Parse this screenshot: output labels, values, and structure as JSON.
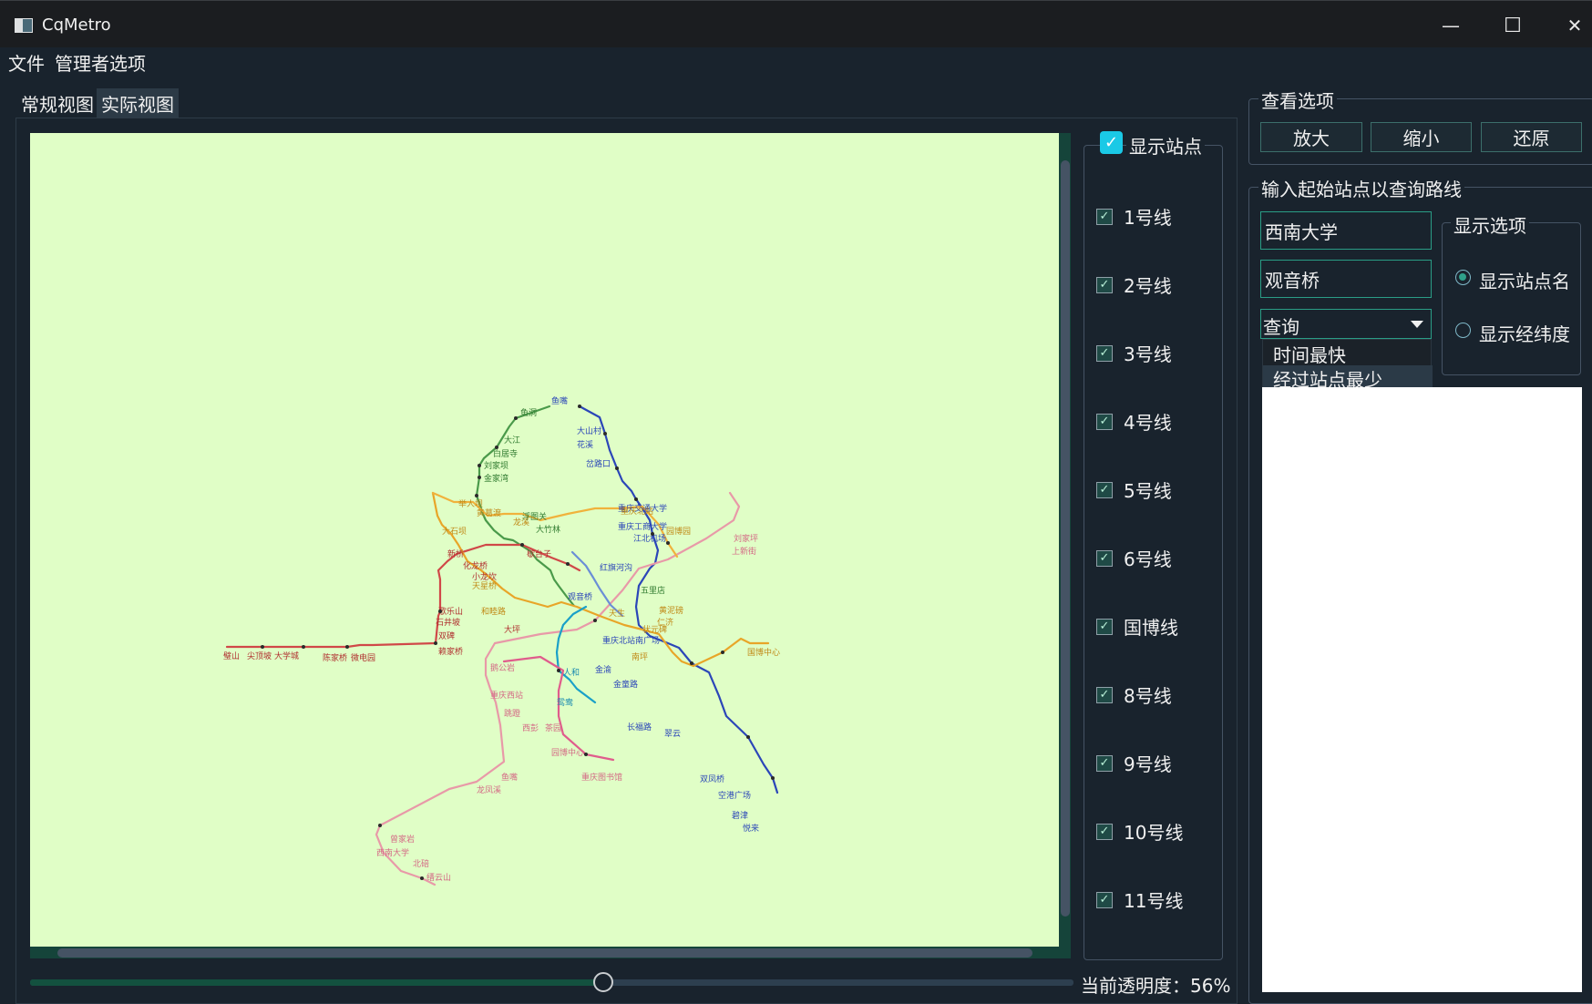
{
  "window": {
    "title": "CqMetro",
    "minimize": "—",
    "maximize": "☐",
    "close": "✕"
  },
  "menu": {
    "file": "文件",
    "admin": "管理者选项"
  },
  "tabs": {
    "normal": "常规视图",
    "actual": "实际视图"
  },
  "map": {
    "background": "#e0fec6",
    "labels": {
      "s1": "鱼洞",
      "s2": "鱼嘴",
      "s3": "大江",
      "s4": "白居寺",
      "s5": "刘家坝",
      "s6": "金家湾",
      "s7": "大山村",
      "s8": "花溪",
      "s9": "岔路口",
      "s10": "重庆交通大学",
      "s11": "重庆工商大学",
      "s12": "刘家坪",
      "s13": "上新街",
      "s14": "璧山",
      "s15": "尖顶坡",
      "s16": "大学城",
      "s17": "陈家桥",
      "s18": "微电园",
      "s19": "歌乐山",
      "s20": "双碑",
      "s21": "赖家桥",
      "s22": "小龙坎",
      "s23": "歇台子",
      "s24": "观音桥",
      "s25": "红旗河沟",
      "s26": "五里店",
      "s27": "黄泥磅",
      "s28": "仁济",
      "s29": "人和",
      "s30": "金渝",
      "s31": "金童路",
      "s32": "重庆北站南广场",
      "s33": "鸳鸯",
      "s34": "长福路",
      "s35": "翠云",
      "s36": "双凤桥",
      "s37": "空港广场",
      "s38": "碧津",
      "s39": "悦来",
      "s40": "南坪",
      "s41": "鹅公岩",
      "s42": "重庆西站",
      "s43": "跳蹬",
      "s44": "西彭",
      "s45": "茶园",
      "s46": "龙凤溪",
      "s47": "重庆图书馆",
      "s48": "园博中心",
      "s49": "西南大学",
      "s50": "北碚",
      "s51": "缙云山",
      "s52": "鱼嘴",
      "s53": "曾家岩",
      "s54": "浮图关",
      "s55": "大竹林",
      "s56": "重庆北站",
      "s57": "江北机场",
      "s58": "举人坝",
      "s59": "黄葛渡",
      "s60": "园博园",
      "s61": "国博中心",
      "s62": "大石坝",
      "s63": "龙溪",
      "s64": "和睦路",
      "s65": "天生",
      "s66": "状元碑",
      "s67": "天星桥",
      "s68": "新桥",
      "s69": "化龙桥",
      "s70": "石井坡",
      "s71": "大坪"
    }
  },
  "toggle": {
    "show_stations": "显示站点"
  },
  "lines": [
    {
      "label": "1号线",
      "color": "#d62728"
    },
    {
      "label": "2号线",
      "color": "#2ca02c"
    },
    {
      "label": "3号线",
      "color": "#1f3fbf"
    },
    {
      "label": "4号线",
      "color": "#ff9f1c"
    },
    {
      "label": "5号线",
      "color": "#00a0c8"
    },
    {
      "label": "6号线",
      "color": "#f082a0"
    },
    {
      "label": "国博线",
      "color": "#e0a020"
    },
    {
      "label": "8号线",
      "color": "#ce4444"
    },
    {
      "label": "9号线",
      "color": "#e05c8c"
    },
    {
      "label": "10号线",
      "color": "#f0b23c"
    },
    {
      "label": "11号线",
      "color": "#5b8ac8"
    }
  ],
  "opacity": {
    "label": "当前透明度：56%",
    "value": 56
  },
  "view_options": {
    "title": "查看选项",
    "zoom_in": "放大",
    "zoom_out": "缩小",
    "reset": "还原"
  },
  "route": {
    "title": "输入起始站点以查询路线",
    "start": "西南大学",
    "end": "观音桥",
    "query": "查询",
    "options": [
      "时间最快",
      "经过站点最少"
    ],
    "display": {
      "title": "显示选项",
      "names": "显示站点名",
      "coords": "显示经纬度",
      "selected": "显示站点名"
    }
  }
}
